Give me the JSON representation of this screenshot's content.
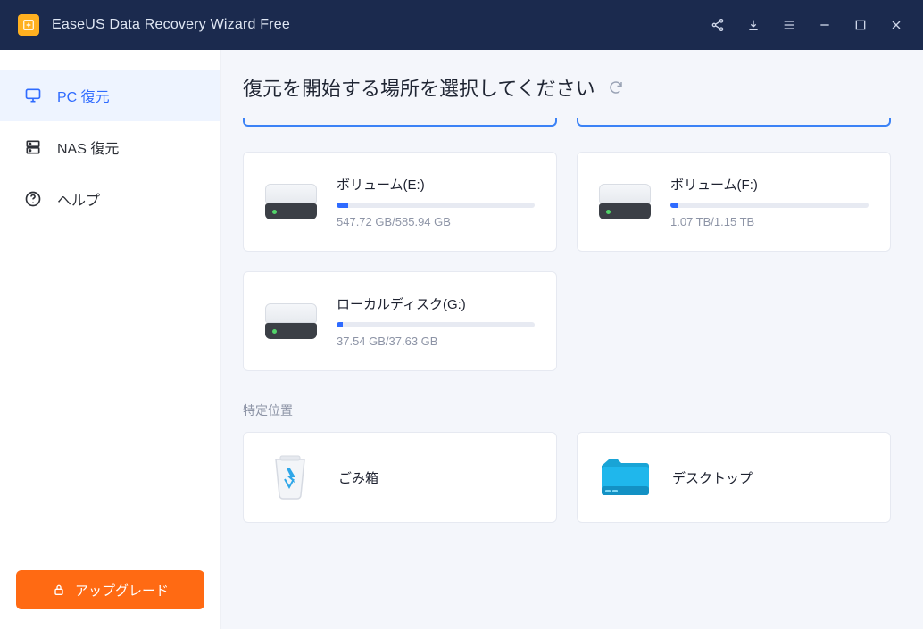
{
  "titlebar": {
    "app_title": "EaseUS Data Recovery Wizard Free"
  },
  "sidebar": {
    "items": [
      {
        "label": "PC 復元"
      },
      {
        "label": "NAS 復元"
      },
      {
        "label": "ヘルプ"
      }
    ],
    "upgrade_label": "アップグレード"
  },
  "main": {
    "heading": "復元を開始する場所を選択してください",
    "drives": [
      {
        "title": "ボリューム(E:)",
        "used": "547.72 GB",
        "total": "585.94 GB",
        "sub": "547.72 GB/585.94 GB",
        "fill_pct": 6
      },
      {
        "title": "ボリューム(F:)",
        "used": "1.07 TB",
        "total": "1.15 TB",
        "sub": "1.07 TB/1.15 TB",
        "fill_pct": 4
      },
      {
        "title": "ローカルディスク(G:)",
        "used": "37.54 GB",
        "total": "37.63 GB",
        "sub": "37.54 GB/37.63 GB",
        "fill_pct": 3
      }
    ],
    "locations_label": "特定位置",
    "locations": [
      {
        "label": "ごみ箱"
      },
      {
        "label": "デスクトップ"
      }
    ]
  }
}
